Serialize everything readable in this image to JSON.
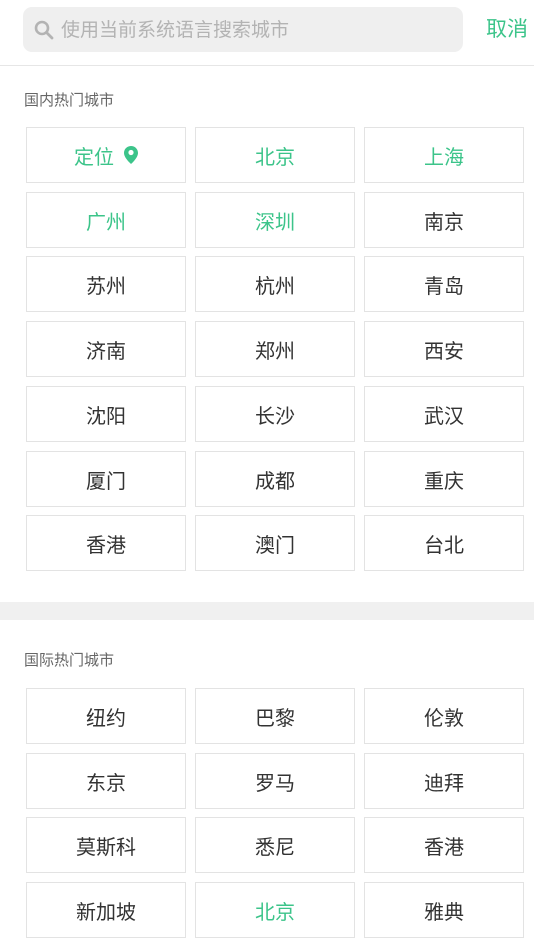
{
  "search": {
    "placeholder": "使用当前系统语言搜索城市",
    "cancel_label": "取消"
  },
  "colors": {
    "accent": "#3cc48a",
    "text": "#333333",
    "muted": "#666666",
    "border": "#e3e3e3",
    "search_bg": "#efefef"
  },
  "domestic": {
    "title": "国内热门城市",
    "cities": [
      {
        "label": "定位",
        "highlight": true,
        "icon": "location-pin-icon"
      },
      {
        "label": "北京",
        "highlight": true
      },
      {
        "label": "上海",
        "highlight": true
      },
      {
        "label": "广州",
        "highlight": true
      },
      {
        "label": "深圳",
        "highlight": true
      },
      {
        "label": "南京",
        "highlight": false
      },
      {
        "label": "苏州",
        "highlight": false
      },
      {
        "label": "杭州",
        "highlight": false
      },
      {
        "label": "青岛",
        "highlight": false
      },
      {
        "label": "济南",
        "highlight": false
      },
      {
        "label": "郑州",
        "highlight": false
      },
      {
        "label": "西安",
        "highlight": false
      },
      {
        "label": "沈阳",
        "highlight": false
      },
      {
        "label": "长沙",
        "highlight": false
      },
      {
        "label": "武汉",
        "highlight": false
      },
      {
        "label": "厦门",
        "highlight": false
      },
      {
        "label": "成都",
        "highlight": false
      },
      {
        "label": "重庆",
        "highlight": false
      },
      {
        "label": "香港",
        "highlight": false
      },
      {
        "label": "澳门",
        "highlight": false
      },
      {
        "label": "台北",
        "highlight": false
      }
    ]
  },
  "international": {
    "title": "国际热门城市",
    "cities": [
      {
        "label": "纽约",
        "highlight": false
      },
      {
        "label": "巴黎",
        "highlight": false
      },
      {
        "label": "伦敦",
        "highlight": false
      },
      {
        "label": "东京",
        "highlight": false
      },
      {
        "label": "罗马",
        "highlight": false
      },
      {
        "label": "迪拜",
        "highlight": false
      },
      {
        "label": "莫斯科",
        "highlight": false
      },
      {
        "label": "悉尼",
        "highlight": false
      },
      {
        "label": "香港",
        "highlight": false
      },
      {
        "label": "新加坡",
        "highlight": false
      },
      {
        "label": "北京",
        "highlight": true
      },
      {
        "label": "雅典",
        "highlight": false
      }
    ]
  }
}
